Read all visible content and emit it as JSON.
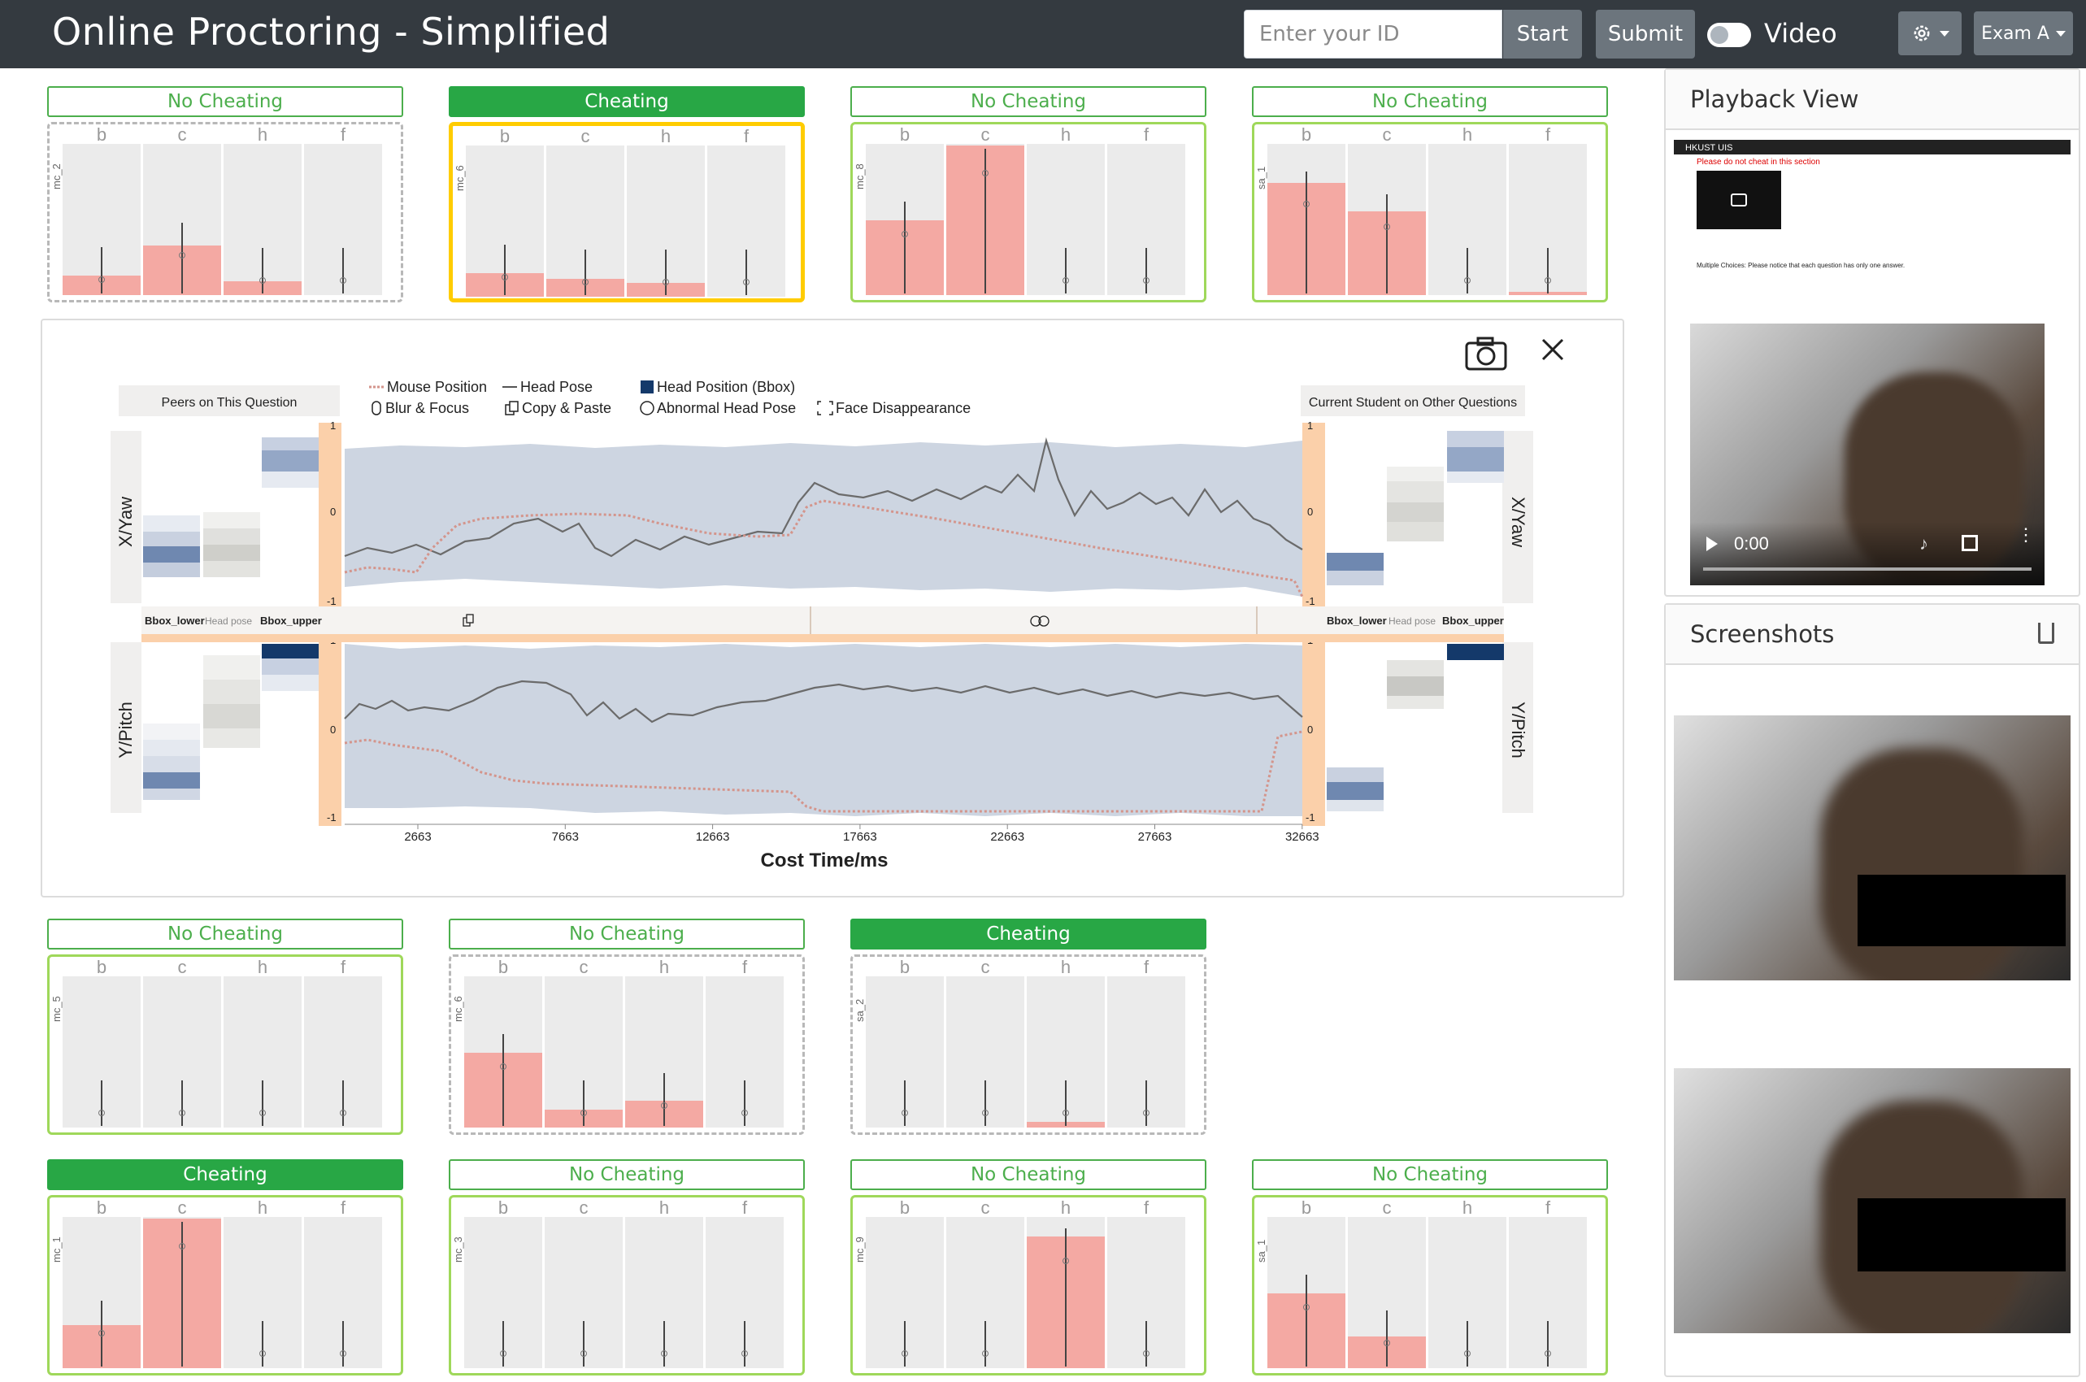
{
  "header": {
    "title": "Online Proctoring - Simplified",
    "id_placeholder": "Enter your ID",
    "start_label": "Start",
    "submit_label": "Submit",
    "video_label": "Video",
    "exam_label": "Exam A"
  },
  "columns": [
    "b",
    "c",
    "h",
    "f"
  ],
  "cards": [
    {
      "status": "No Cheating",
      "qid": "mc_2",
      "style": "dashed",
      "values": [
        0.13,
        0.33,
        0.09,
        0.0
      ]
    },
    {
      "status": "Cheating",
      "qid": "mc_6",
      "style": "selected",
      "values": [
        0.16,
        0.12,
        0.09,
        0.0
      ]
    },
    {
      "status": "No Cheating",
      "qid": "mc_8",
      "style": "solid",
      "values": [
        0.5,
        1.0,
        0.0,
        0.0
      ]
    },
    {
      "status": "No Cheating",
      "qid": "sa_1",
      "style": "solid",
      "values": [
        0.75,
        0.56,
        0.0,
        0.02
      ]
    },
    {
      "status": "No Cheating",
      "qid": "mc_5",
      "style": "solid",
      "values": [
        0.0,
        0.0,
        0.0,
        0.0
      ]
    },
    {
      "status": "No Cheating",
      "qid": "mc_6",
      "style": "dashed",
      "values": [
        0.5,
        0.12,
        0.18,
        0.0
      ]
    },
    {
      "status": "Cheating",
      "qid": "sa_2",
      "style": "dashed",
      "values": [
        0.0,
        0.0,
        0.04,
        0.0
      ]
    },
    {
      "status": "Cheating",
      "qid": "mc_1",
      "style": "solid",
      "values": [
        0.29,
        1.0,
        0.0,
        0.0
      ]
    },
    {
      "status": "No Cheating",
      "qid": "mc_3",
      "style": "solid",
      "values": [
        0.0,
        0.0,
        0.0,
        0.0
      ]
    },
    {
      "status": "No Cheating",
      "qid": "mc_9",
      "style": "solid",
      "values": [
        0.0,
        0.0,
        0.88,
        0.0
      ]
    },
    {
      "status": "No Cheating",
      "qid": "sa_1",
      "style": "solid",
      "values": [
        0.5,
        0.21,
        0.0,
        0.0
      ]
    }
  ],
  "detail": {
    "peers_label": "Peers on This Question",
    "current_label": "Current Student on Other Questions",
    "legend": {
      "mouse": "Mouse Position",
      "head_pose": "Head Pose",
      "head_bbox": "Head Position (Bbox)",
      "blur": "Blur & Focus",
      "copy": "Copy & Paste",
      "abnormal": "Abnormal Head Pose",
      "face": "Face Disappearance"
    },
    "top_axis_label": "X/Yaw",
    "bottom_axis_label": "Y/Pitch",
    "mid_left": [
      "Bbox_lower",
      "Head pose",
      "Bbox_upper"
    ],
    "mid_right": [
      "Bbox_lower",
      "Head pose",
      "Bbox_upper"
    ],
    "y_ticks": [
      "1",
      "0",
      "-1"
    ],
    "x_ticks": [
      "2663",
      "7663",
      "12663",
      "17663",
      "22663",
      "27663",
      "32663"
    ],
    "x_label": "Cost Time/ms"
  },
  "playback": {
    "title": "Playback View",
    "time": "0:00",
    "page_header": "HKUST UIS",
    "page_warning": "Please do not cheat in this section",
    "page_question": "Multiple Choices: Please notice that each question has only one answer."
  },
  "screenshots": {
    "title": "Screenshots"
  },
  "colors": {
    "navbar": "#343a40",
    "cheat_green": "#28a745",
    "bar_pink": "#f4a9a3",
    "band_blue": "#cdd5e1",
    "selected_yellow": "#ffcc00"
  }
}
